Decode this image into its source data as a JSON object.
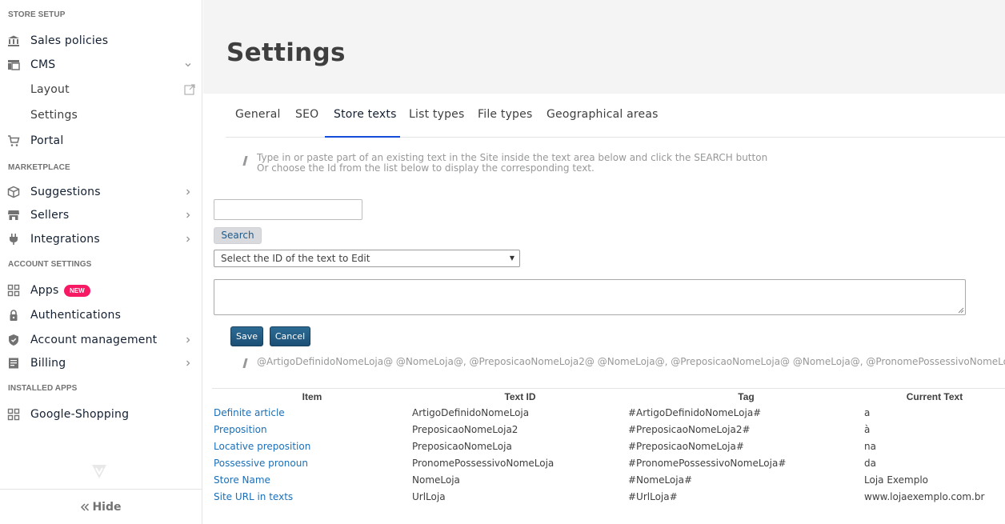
{
  "sidebar": {
    "sections": {
      "store_setup": "STORE SETUP",
      "marketplace": "MARKETPLACE",
      "account_settings": "ACCOUNT SETTINGS",
      "installed_apps": "INSTALLED APPS"
    },
    "items": {
      "sales_policies": "Sales policies",
      "cms": "CMS",
      "layout": "Layout",
      "settings": "Settings",
      "portal": "Portal",
      "suggestions": "Suggestions",
      "sellers": "Sellers",
      "integrations": "Integrations",
      "apps": "Apps",
      "apps_badge": "NEW",
      "authentications": "Authentications",
      "account_management": "Account management",
      "billing": "Billing",
      "google_shopping": "Google-Shopping"
    },
    "hide_label": "Hide",
    "badge_color": "#f71963"
  },
  "page": {
    "title": "Settings",
    "tabs": [
      "General",
      "SEO",
      "Store texts",
      "List types",
      "File types",
      "Geographical areas"
    ],
    "active_tab": "Store texts"
  },
  "store_texts": {
    "hint_line1": "Type in or paste part of an existing text in the Site inside the text area below and click the SEARCH button",
    "hint_line2": "Or choose the Id from the list below to display the corresponding text.",
    "search_value": "",
    "search_button": "Search",
    "select_value": "Select the ID of the text to Edit",
    "textarea_value": "",
    "save_button": "Save",
    "cancel_button": "Cancel",
    "tags_hint": "@ArtigoDefinidoNomeLoja@ @NomeLoja@, @PreposicaoNomeLoja2@ @NomeLoja@, @PreposicaoNomeLoja@ @NomeLoja@, @PronomePossessivoNomeLoja@ @NomeLoja@",
    "table": {
      "headers": [
        "Item",
        "Text ID",
        "Tag",
        "Current Text"
      ],
      "rows": [
        [
          "Definite article",
          "ArtigoDefinidoNomeLoja",
          "#ArtigoDefinidoNomeLoja#",
          "a"
        ],
        [
          "Preposition",
          "PreposicaoNomeLoja2",
          "#PreposicaoNomeLoja2#",
          "à"
        ],
        [
          "Locative preposition",
          "PreposicaoNomeLoja",
          "#PreposicaoNomeLoja#",
          "na"
        ],
        [
          "Possessive pronoun",
          "PronomePossessivoNomeLoja",
          "#PronomePossessivoNomeLoja#",
          "da"
        ],
        [
          "Store Name",
          "NomeLoja",
          "#NomeLoja#",
          "Loja Exemplo"
        ],
        [
          "Site URL in texts",
          "UrlLoja",
          "#UrlLoja#",
          "www.lojaexemplo.com.br"
        ]
      ]
    }
  },
  "colors": {
    "accent": "#134cd8",
    "link": "#1a6fb8",
    "button_dark": "#1c4f75"
  }
}
